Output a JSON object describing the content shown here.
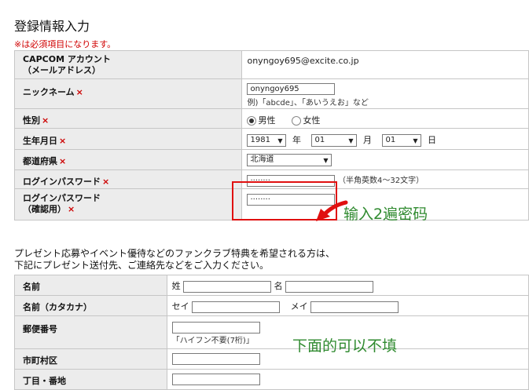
{
  "page": {
    "title": "登録情報入力",
    "required_note": "※は必須項目になります。"
  },
  "form1": {
    "account_label_1": "CAPCOM アカウント",
    "account_label_2": "（メールアドレス）",
    "account_value": "onyngoy695@excite.co.jp",
    "nickname_label": "ニックネーム",
    "nickname_value": "onyngoy695",
    "nickname_hint": "例)「abcde」、「あいうえお」など",
    "gender_label": "性別",
    "gender_male": "男性",
    "gender_female": "女性",
    "gender_selected": "male",
    "birth_label": "生年月日",
    "birth_year": "1981",
    "birth_year_unit": "年",
    "birth_month": "01",
    "birth_month_unit": "月",
    "birth_day": "01",
    "birth_day_unit": "日",
    "pref_label": "都道府県",
    "pref_value": "北海道",
    "password_label": "ログインパスワード",
    "password_value": "········",
    "password_hint": "（半角英数4〜32文字）",
    "password_confirm_label_1": "ログインパスワード",
    "password_confirm_label_2": "（確認用）",
    "password_confirm_value": "········",
    "required_mark": "×"
  },
  "section2": {
    "line1": "プレゼント応募やイベント優待などのファンクラブ特典を希望される方は、",
    "line2": "下記にプレゼント送付先、ご連絡先などをご入力ください。"
  },
  "form2": {
    "name_label": "名前",
    "last_name_prefix": "姓",
    "first_name_prefix": "名",
    "kana_label": "名前（カタカナ）",
    "kana_last_prefix": "セイ",
    "kana_first_prefix": "メイ",
    "zip_label": "郵便番号",
    "zip_hint": "「ハイフン不要(7桁)」",
    "city_label": "市町村区",
    "address_label": "丁目・番地"
  },
  "annotations": {
    "enter_twice": "输入2遍密码",
    "below_optional": "下面的可以不填"
  },
  "colors": {
    "label_bg": "#ececec",
    "required_red": "#cc0000",
    "annotation_green": "#2f8a2f",
    "highlight_red": "#e01010"
  }
}
